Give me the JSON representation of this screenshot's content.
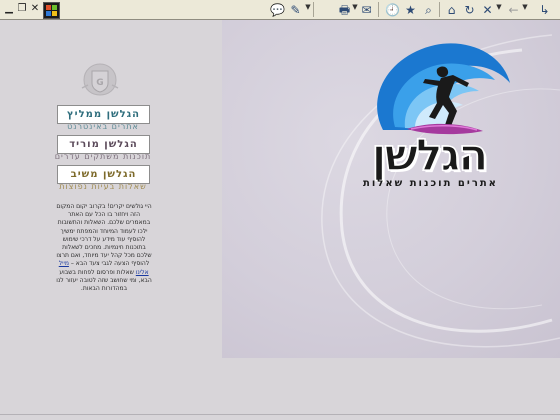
{
  "toolbar": {
    "buttons": [
      {
        "name": "chat-icon",
        "glyph": "💬"
      },
      {
        "name": "edit-icon",
        "glyph": "✎"
      },
      {
        "name": "print-icon",
        "glyph": "🖶"
      },
      {
        "name": "mail-icon",
        "glyph": "✉"
      },
      {
        "name": "history-icon",
        "glyph": "🕘"
      },
      {
        "name": "favorites-icon",
        "glyph": "★"
      },
      {
        "name": "home-icon",
        "glyph": "⌂"
      },
      {
        "name": "refresh-icon",
        "glyph": "↻"
      },
      {
        "name": "stop-icon",
        "glyph": "✕"
      },
      {
        "name": "back-icon",
        "glyph": "←"
      },
      {
        "name": "forward-icon",
        "glyph": "↳"
      }
    ]
  },
  "nav": {
    "recommend": {
      "label": "הגלשן ממליץ",
      "sub": "אתרים באינטרנט",
      "color": "#2f6e7d"
    },
    "downloads": {
      "label": "הגלשן מוריד",
      "sub": "תוכנות משתקים עדרים",
      "color": "#5b4a5a"
    },
    "answers": {
      "label": "הגלשן משיב",
      "sub": "שאלות בעיות נפוצות",
      "color": "#7d6a2a"
    }
  },
  "intro": {
    "text_1": "היי גולשים יקרים! בקרוב יקום המקום הזה ויחזור בו הכל עם האתר במאמרים שלכם. השאלות והתשובות ילכו לעמוד המיוחד והמפתח ימשיך להוסיף עוד מידע על דרכי שימוש בתוכנות חינמיות. מחכים לשאלות שלכם מכל קהל יעד מיוחד, ואם תרצו להוסיף הצעה לגבי צעד הבא –",
    "link": "מייל אלינו",
    "text_2": "שאלות ופרסום לפחות בשבוע הבא, ומי שחושב שזה לטובה יעזור לנו במהדורות הבאות."
  },
  "logo": {
    "wordmark": "הגלשן",
    "tagline": "אתרים תוכנות שאלות"
  }
}
